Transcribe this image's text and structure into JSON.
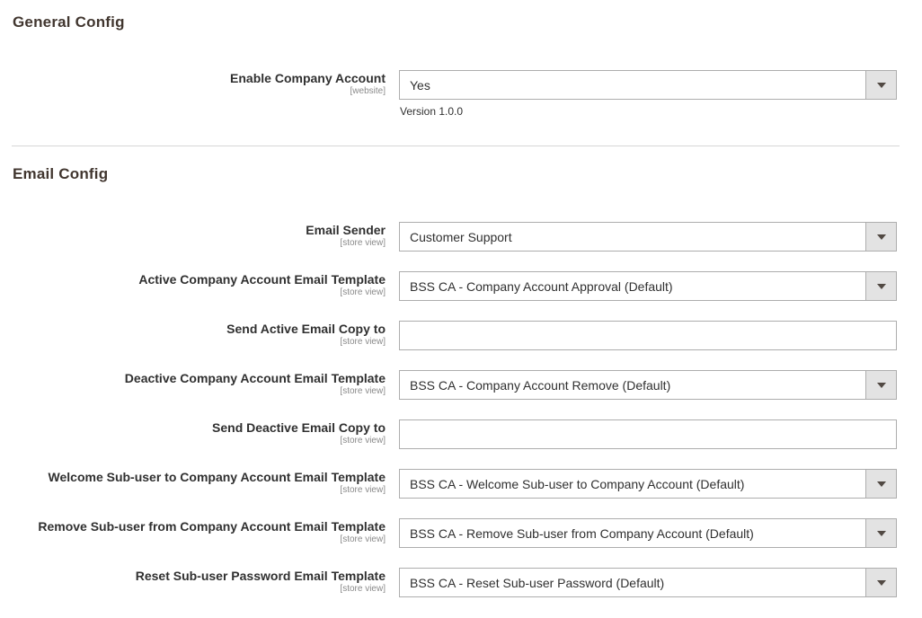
{
  "sections": [
    {
      "title": "General Config",
      "fields": [
        {
          "label": "Enable Company Account",
          "scope": "[website]",
          "type": "select",
          "value": "Yes",
          "note": "Version 1.0.0"
        }
      ]
    },
    {
      "title": "Email Config",
      "fields": [
        {
          "label": "Email Sender",
          "scope": "[store view]",
          "type": "select",
          "value": "Customer Support"
        },
        {
          "label": "Active Company Account Email Template",
          "scope": "[store view]",
          "type": "select",
          "value": "BSS CA - Company Account Approval (Default)"
        },
        {
          "label": "Send Active Email Copy to",
          "scope": "[store view]",
          "type": "text",
          "value": ""
        },
        {
          "label": "Deactive Company Account Email Template",
          "scope": "[store view]",
          "type": "select",
          "value": "BSS CA - Company Account Remove (Default)"
        },
        {
          "label": "Send Deactive Email Copy to",
          "scope": "[store view]",
          "type": "text",
          "value": ""
        },
        {
          "label": "Welcome Sub-user to Company Account Email Template",
          "scope": "[store view]",
          "type": "select",
          "value": "BSS CA - Welcome Sub-user to Company Account (Default)"
        },
        {
          "label": "Remove Sub-user from Company Account Email Template",
          "scope": "[store view]",
          "type": "select",
          "value": "BSS CA - Remove Sub-user from Company Account (Default)"
        },
        {
          "label": "Reset Sub-user Password Email Template",
          "scope": "[store view]",
          "type": "select",
          "value": "BSS CA - Reset Sub-user Password (Default)"
        }
      ]
    }
  ],
  "icons": {
    "dropdown": "chevron-down-icon"
  }
}
